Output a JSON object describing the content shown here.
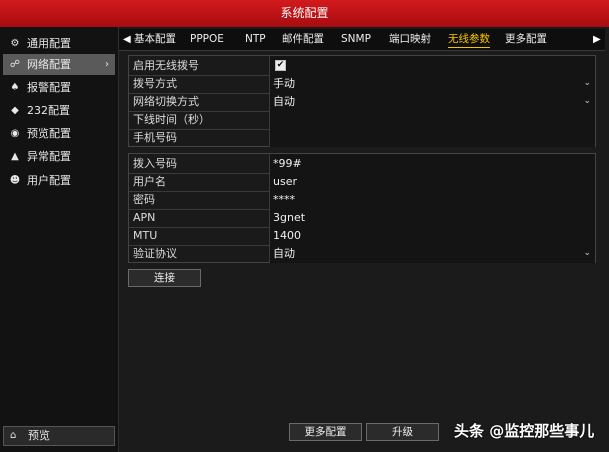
{
  "window": {
    "title": "系统配置"
  },
  "sidebar": {
    "items": [
      {
        "label": "通用配置",
        "icon": "gear-icon",
        "glyph": "⚙"
      },
      {
        "label": "网络配置",
        "icon": "network-icon",
        "glyph": "☍",
        "active": true,
        "chevron": "›"
      },
      {
        "label": "报警配置",
        "icon": "alarm-icon",
        "glyph": "♠"
      },
      {
        "label": "232配置",
        "icon": "rs232-icon",
        "glyph": "◆"
      },
      {
        "label": "预览配置",
        "icon": "preview-icon",
        "glyph": "◉"
      },
      {
        "label": "异常配置",
        "icon": "warning-icon",
        "glyph": "▲"
      },
      {
        "label": "用户配置",
        "icon": "users-icon",
        "glyph": "☻"
      }
    ],
    "preview_button": {
      "label": "预览",
      "icon": "home-icon",
      "glyph": "⌂"
    }
  },
  "tabs": {
    "left_arrow": "◀",
    "right_arrow": "▶",
    "items": [
      "基本配置",
      "PPPOE",
      "NTP",
      "邮件配置",
      "SNMP",
      "端口映射",
      "无线参数",
      "更多配置"
    ],
    "active": "无线参数"
  },
  "form1": {
    "enable_wireless_dial": {
      "label": "启用无线拨号",
      "checked": true,
      "check_mark": "✔"
    },
    "dial_mode": {
      "label": "拨号方式",
      "value": "手动"
    },
    "network_switch_mode": {
      "label": "网络切换方式",
      "value": "自动"
    },
    "offline_time": {
      "label": "下线时间（秒）",
      "value": ""
    },
    "phone_number": {
      "label": "手机号码",
      "value": ""
    }
  },
  "form2": {
    "access_number": {
      "label": "拨入号码",
      "value": "*99#"
    },
    "username": {
      "label": "用户名",
      "value": "user"
    },
    "password": {
      "label": "密码",
      "value": "****"
    },
    "apn": {
      "label": "APN",
      "value": "3gnet"
    },
    "mtu": {
      "label": "MTU",
      "value": "1400"
    },
    "auth_protocol": {
      "label": "验证协议",
      "value": "自动"
    }
  },
  "caret_glyph": "⌄",
  "connect_button": {
    "label": "连接"
  },
  "footer": {
    "more_config_label": "更多配置",
    "upgrade_label": "升级"
  },
  "watermark": "头条 @监控那些事儿",
  "colors": {
    "titlebar": "#c8141a",
    "active_tab": "#f5c400",
    "active_sidebar": "#5a5a5a"
  }
}
